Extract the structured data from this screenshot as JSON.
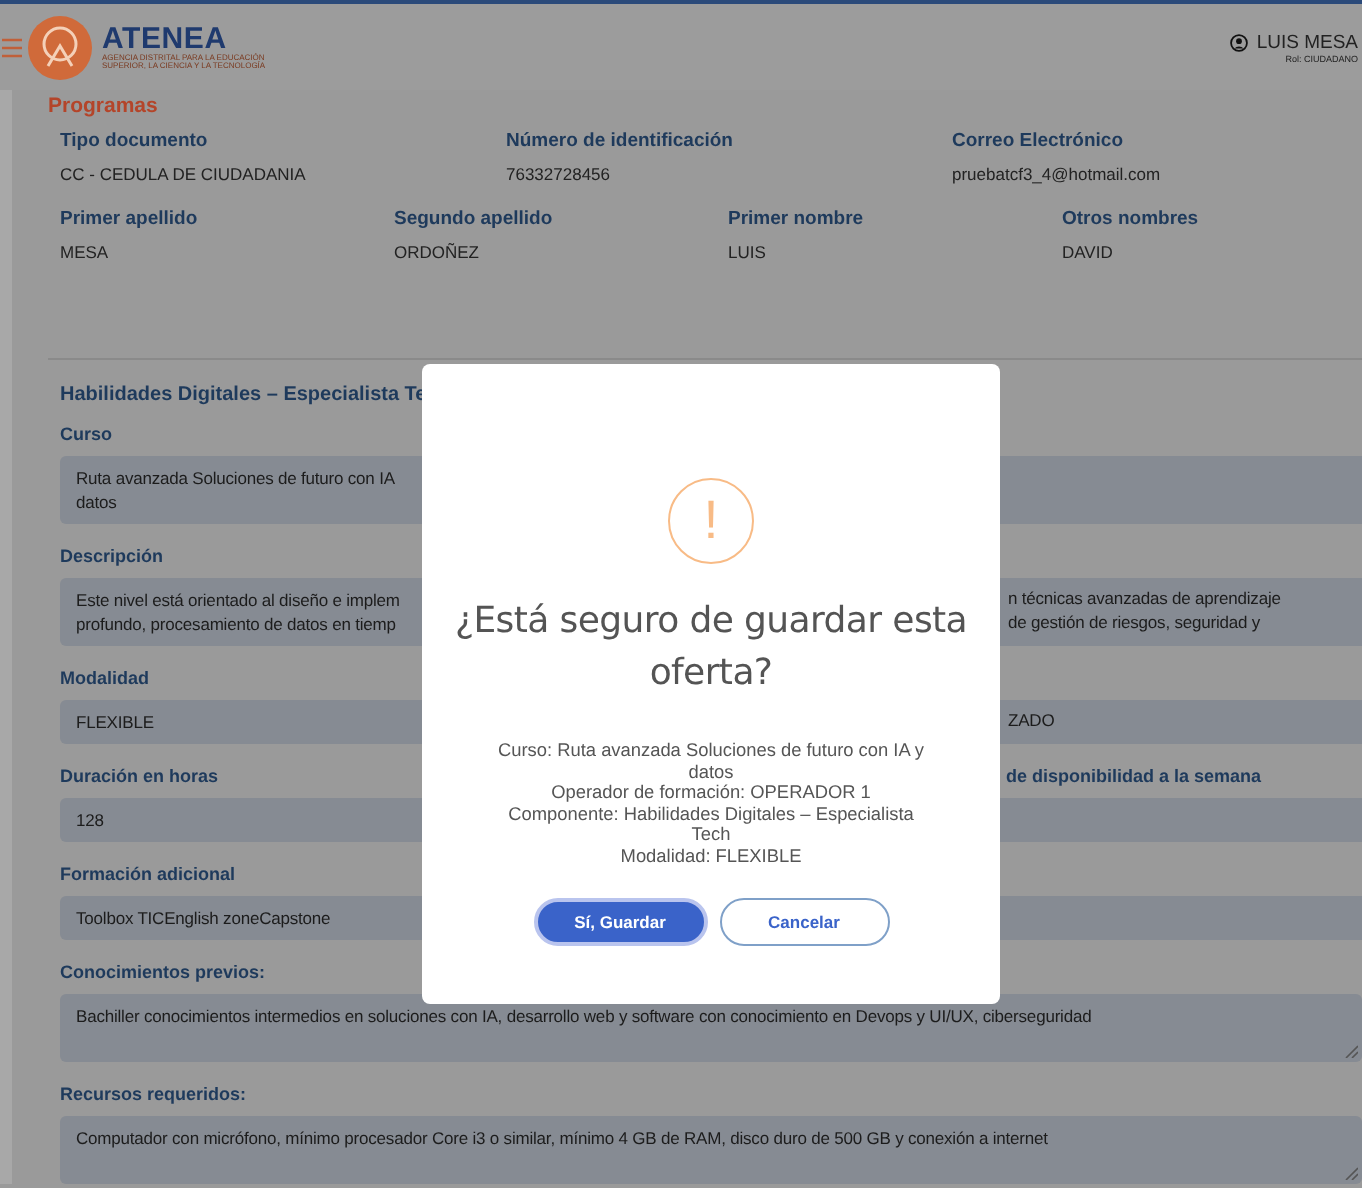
{
  "header": {
    "brand": "ATENEA",
    "brand_subtitle": [
      "AGENCIA DISTRITAL PARA LA EDUCACIÓN",
      "SUPERIOR, LA CIENCIA Y LA TECNOLOGÍA"
    ],
    "user_name": "LUIS MESA",
    "user_role": "Rol: CIUDADANO"
  },
  "section_title": "Programas",
  "person_rows": [
    [
      {
        "label": "Tipo documento",
        "value": "CC - CEDULA DE CIUDADANIA"
      },
      {
        "label": "Número de identificación",
        "value": "76332728456"
      },
      {
        "label": "Correo Electrónico",
        "value": "pruebatcf3_4@hotmail.com"
      }
    ],
    [
      {
        "label": "Primer apellido",
        "value": "MESA"
      },
      {
        "label": "Segundo apellido",
        "value": "ORDOÑEZ"
      },
      {
        "label": "Primer nombre",
        "value": "LUIS"
      },
      {
        "label": "Otros nombres",
        "value": "DAVID"
      }
    ]
  ],
  "offer": {
    "title": "Habilidades Digitales – Especialista Te",
    "fields": [
      {
        "kind": "input",
        "label": "Curso",
        "lines": [
          "Ruta avanzada Soluciones de futuro con IA",
          "datos"
        ]
      },
      {
        "kind": "input",
        "label": "Descripción",
        "lines": [
          "Este nivel está orientado al diseño e implem",
          "profundo, procesamiento de datos en tiemp"
        ],
        "lines_right": [
          "n técnicas avanzadas de aprendizaje",
          "de gestión de riesgos, seguridad y"
        ]
      },
      {
        "kind": "input",
        "label": "Modalidad",
        "lines": [
          "FLEXIBLE"
        ],
        "lines_right": [
          "ZADO"
        ]
      },
      {
        "kind": "input",
        "label": "Duración en horas",
        "label_right": "de disponibilidad a la semana",
        "lines": [
          "128"
        ]
      },
      {
        "kind": "input",
        "label": "Formación adicional",
        "lines": [
          "Toolbox TICEnglish zoneCapstone"
        ]
      },
      {
        "kind": "textarea",
        "label": "Conocimientos previos:",
        "lines": [
          "Bachiller conocimientos intermedios en soluciones con IA, desarrollo web y software con conocimiento en Devops y UI/UX, ciberseguridad"
        ]
      },
      {
        "kind": "textarea",
        "label": "Recursos requeridos:",
        "lines": [
          "Computador con micrófono, mínimo procesador Core i3 o similar, mínimo 4 GB de RAM, disco duro de 500 GB y conexión a internet"
        ]
      }
    ]
  },
  "dialog": {
    "icon": "!",
    "title": "¿Está seguro de guardar esta oferta?",
    "details": [
      "Curso: Ruta avanzada Soluciones de futuro con IA y datos",
      "Operador de formación: OPERADOR 1",
      "Componente: Habilidades Digitales – Especialista Tech",
      "Modalidad: FLEXIBLE"
    ],
    "buttons": [
      {
        "kind": "confirm",
        "label": "Sí, Guardar"
      },
      {
        "kind": "cancel",
        "label": "Cancelar"
      }
    ]
  }
}
